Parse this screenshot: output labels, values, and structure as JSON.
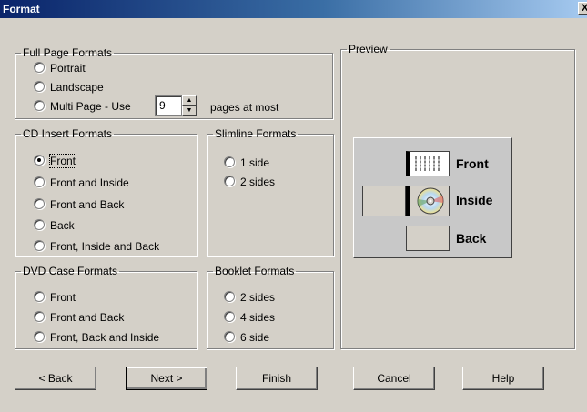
{
  "window": {
    "title": "Format",
    "close_label": "X"
  },
  "full_page": {
    "title": "Full Page Formats",
    "options": [
      "Portrait",
      "Landscape",
      "Multi Page - Use"
    ],
    "pages_value": "9",
    "pages_suffix": "pages at most"
  },
  "cd_insert": {
    "title": "CD Insert Formats",
    "options": [
      "Front",
      "Front and Inside",
      "Front and Back",
      "Back",
      "Front, Inside and Back"
    ],
    "selected": "Front"
  },
  "slimline": {
    "title": "Slimline Formats",
    "options": [
      "1 side",
      "2 sides"
    ]
  },
  "dvd_case": {
    "title": "DVD Case Formats",
    "options": [
      "Front",
      "Front and Back",
      "Front, Back and Inside"
    ]
  },
  "booklet": {
    "title": "Booklet Formats",
    "options": [
      "2 sides",
      "4 sides",
      "6 side"
    ]
  },
  "preview": {
    "title": "Preview",
    "labels": [
      "Front",
      "Inside",
      "Back"
    ]
  },
  "buttons": {
    "back": "< Back",
    "next": "Next >",
    "finish": "Finish",
    "cancel": "Cancel",
    "help": "Help"
  }
}
